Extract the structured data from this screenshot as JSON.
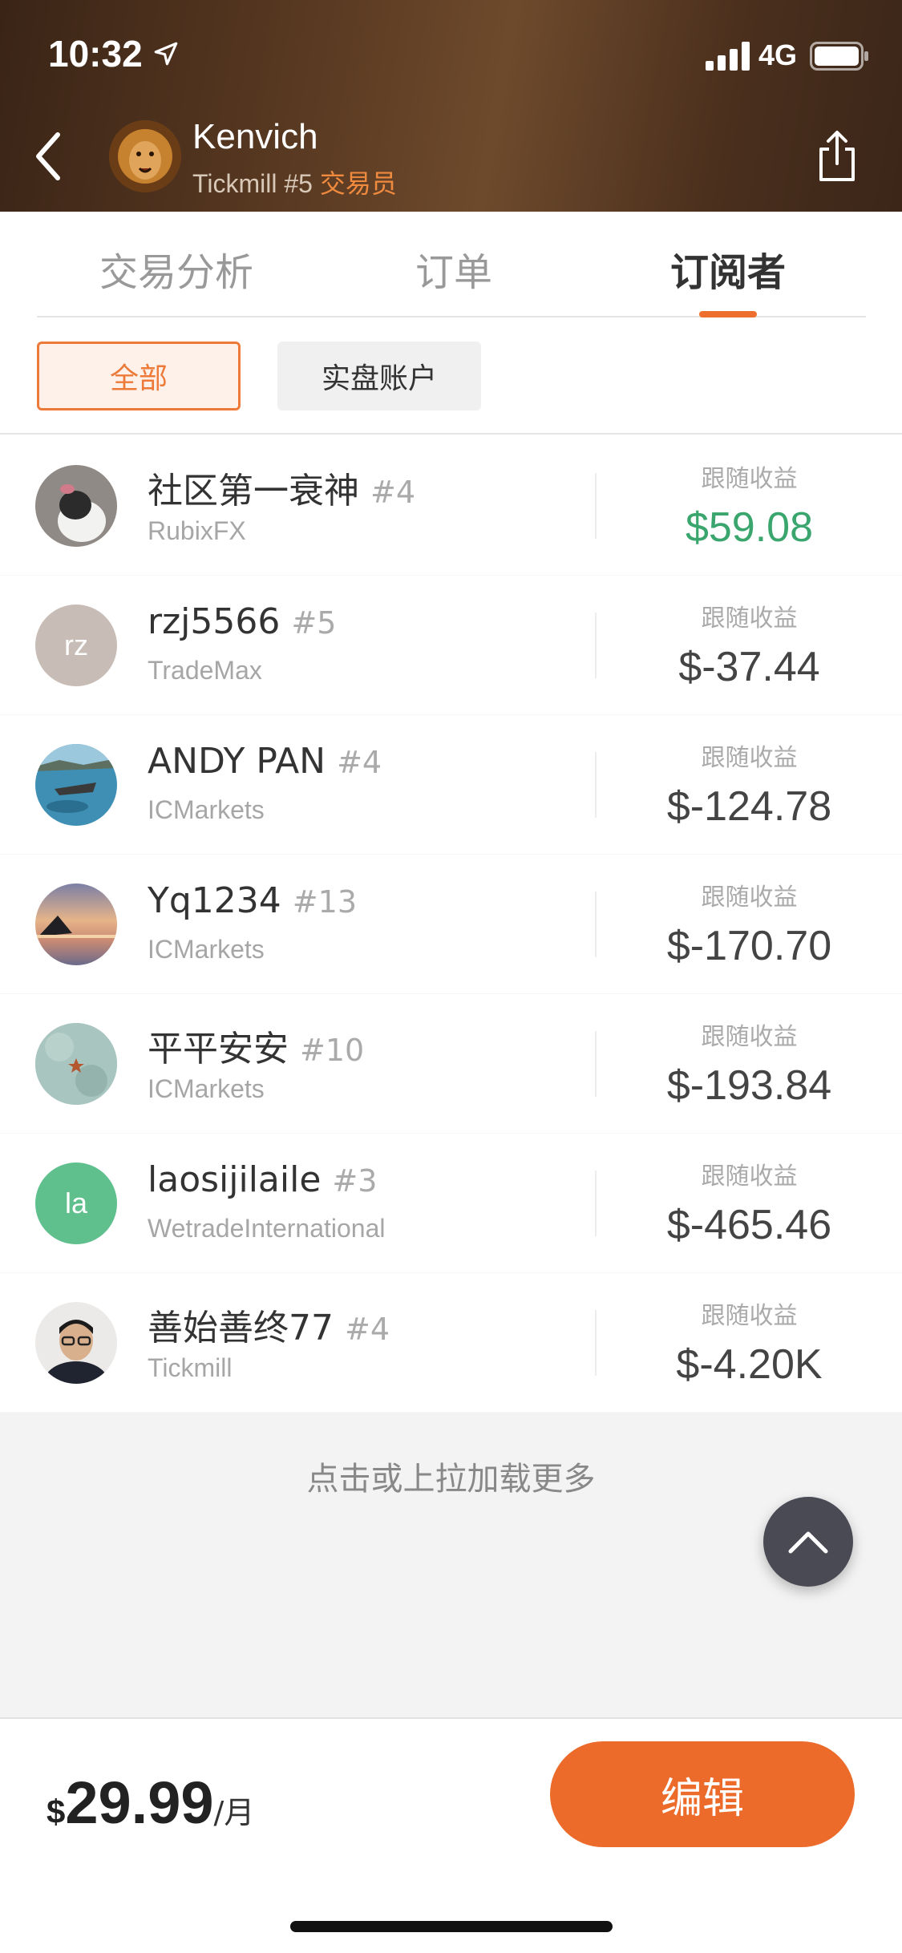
{
  "status_bar": {
    "time": "10:32",
    "network": "4G"
  },
  "header": {
    "trader_name": "Kenvich",
    "broker_rank": "Tickmill #5 ",
    "role": "交易员"
  },
  "tabs": [
    {
      "label": "交易分析",
      "active": false
    },
    {
      "label": "订单",
      "active": false
    },
    {
      "label": "订阅者",
      "active": true
    }
  ],
  "filters": [
    {
      "label": "全部",
      "active": true
    },
    {
      "label": "实盘账户",
      "active": false
    }
  ],
  "earnings_label": "跟随收益",
  "subscribers": [
    {
      "name": "社区第一衰神",
      "rank": "#4",
      "broker": "RubixFX",
      "earnings": "$59.08",
      "positive": true,
      "avatar_initials": ""
    },
    {
      "name": "rzj5566",
      "rank": "#5",
      "broker": "TradeMax",
      "earnings": "$-37.44",
      "positive": false,
      "avatar_initials": "rz"
    },
    {
      "name": "ANDY PAN",
      "rank": "#4",
      "broker": "ICMarkets",
      "earnings": "$-124.78",
      "positive": false,
      "avatar_initials": ""
    },
    {
      "name": "Yq1234",
      "rank": "#13",
      "broker": "ICMarkets",
      "earnings": "$-170.70",
      "positive": false,
      "avatar_initials": ""
    },
    {
      "name": "平平安安",
      "rank": "#10",
      "broker": "ICMarkets",
      "earnings": "$-193.84",
      "positive": false,
      "avatar_initials": ""
    },
    {
      "name": "laosijilaile",
      "rank": "#3",
      "broker": "WetradeInternational",
      "earnings": "$-465.46",
      "positive": false,
      "avatar_initials": "la"
    },
    {
      "name": "善始善终77",
      "rank": "#4",
      "broker": "Tickmill",
      "earnings": "$-4.20K",
      "positive": false,
      "avatar_initials": ""
    }
  ],
  "load_more": "点击或上拉加载更多",
  "footer": {
    "currency": "$",
    "price": "29.99",
    "unit": "/月",
    "edit_label": "编辑"
  },
  "colors": {
    "accent": "#ee6f2d",
    "positive": "#3aa66e",
    "header_bg": "#4a2f1d"
  }
}
